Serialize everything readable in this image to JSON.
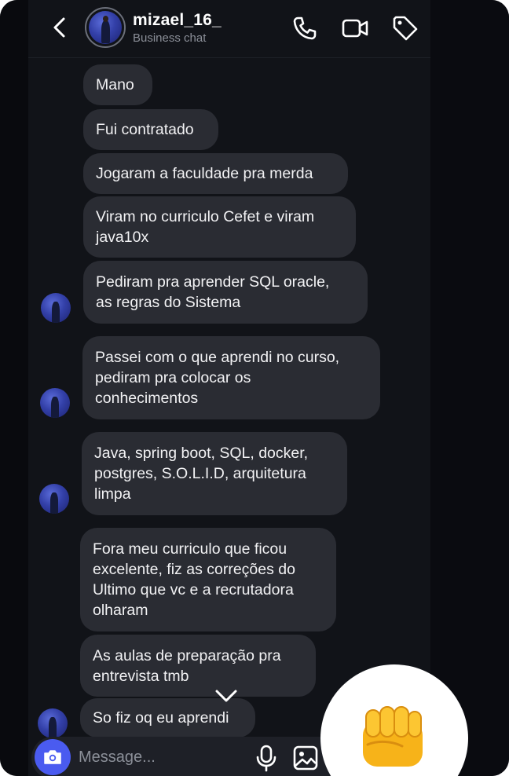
{
  "header": {
    "username": "mizael_16_",
    "subtitle": "Business chat",
    "icons": [
      "chevron-left-icon",
      "phone-icon",
      "video-camera-icon",
      "tag-icon"
    ]
  },
  "messages": [
    {
      "text": "Mano",
      "avatar": false
    },
    {
      "text": "Fui contratado",
      "avatar": false
    },
    {
      "text": "Jogaram a faculdade pra merda",
      "avatar": false
    },
    {
      "text": "Viram no curriculo Cefet e viram\njava10x",
      "avatar": false
    },
    {
      "text": "Pediram pra aprender SQL oracle,\nas regras do Sistema",
      "avatar": true
    },
    {
      "text": "Passei com o que aprendi no curso,\npediram pra colocar os\nconhecimentos",
      "avatar": true
    },
    {
      "text": "Java, spring boot, SQL, docker,\npostgres, S.O.L.I.D, arquitetura\nlimpa",
      "avatar": true
    },
    {
      "text": "Fora meu curriculo que ficou\nexcelente, fiz as correções do\nUltimo que vc e a recrutadora\nolharam",
      "avatar": false
    },
    {
      "text": "As aulas de preparação pra\nentrevista tmb",
      "avatar": false
    },
    {
      "text": "So fiz oq eu aprendi",
      "avatar": true
    }
  ],
  "composer": {
    "placeholder": "Message...",
    "icons": [
      "camera-icon",
      "microphone-icon",
      "image-icon"
    ]
  },
  "reaction": {
    "emoji": "fist-bump",
    "symbol": "👊"
  },
  "colors": {
    "background": "#111318",
    "bubble": "#2a2c33",
    "text": "#f2f2f4",
    "subtext": "#8b8f98",
    "accent": "#4a5bf0"
  }
}
